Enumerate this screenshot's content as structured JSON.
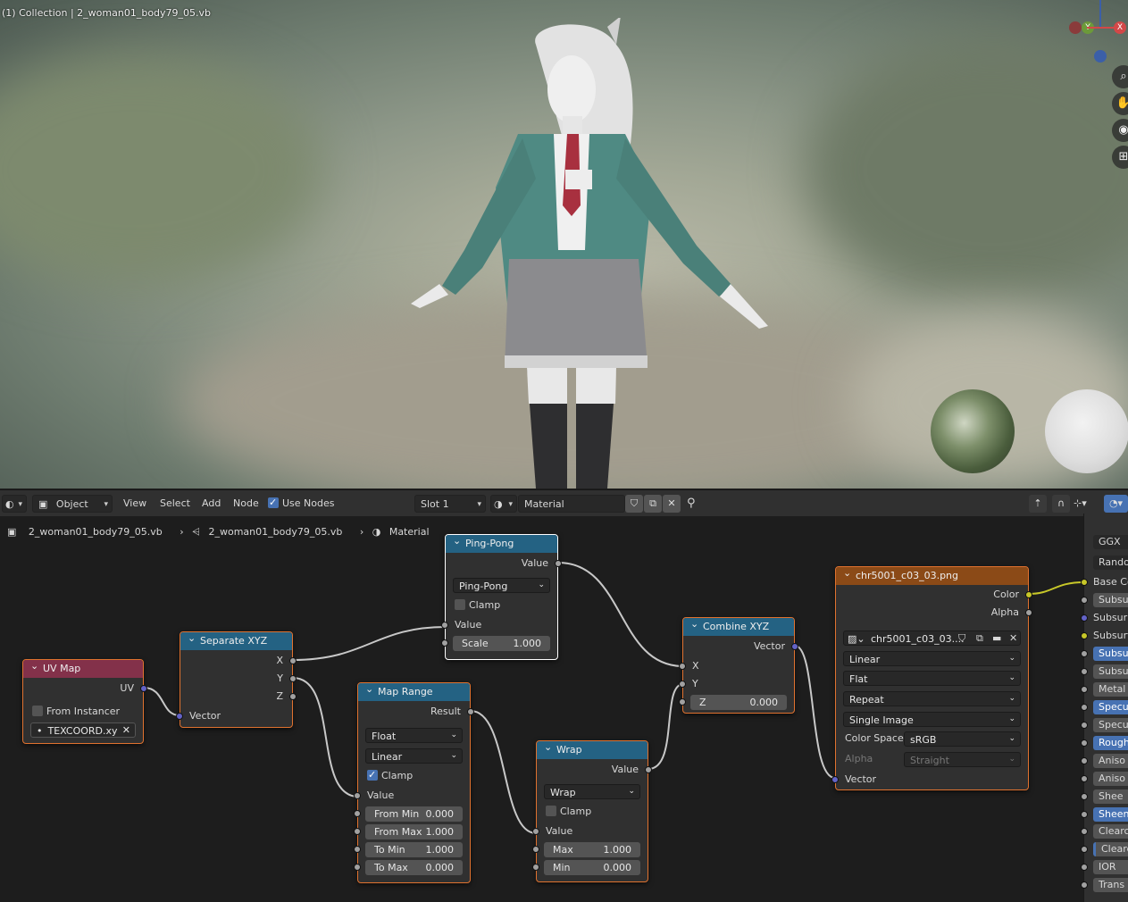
{
  "viewport": {
    "title": "(1) Collection | 2_woman01_body79_05.vb",
    "gizmo": {
      "x_label": "X",
      "y_label": "Y"
    },
    "nav_icons": [
      "zoom-icon",
      "pan-hand-icon",
      "camera-icon",
      "grid-icon"
    ]
  },
  "header": {
    "editor_type_icon": "node-editor-icon",
    "mode": "Object",
    "menus": [
      "View",
      "Select",
      "Add",
      "Node"
    ],
    "use_nodes_label": "Use Nodes",
    "use_nodes_checked": true,
    "slot": "Slot 1",
    "material_name": "Material"
  },
  "breadcrumb": {
    "object": "2_woman01_body79_05.vb",
    "mesh": "2_woman01_body79_05.vb",
    "material": "Material"
  },
  "nodes": {
    "uv_map": {
      "title": "UV Map",
      "out_uv": "UV",
      "from_instancer": "From Instancer",
      "uv_name": "TEXCOORD.xy"
    },
    "separate_xyz": {
      "title": "Separate XYZ",
      "x": "X",
      "y": "Y",
      "z": "Z",
      "vector": "Vector"
    },
    "ping_pong": {
      "title": "Ping-Pong",
      "out": "Value",
      "op": "Ping-Pong",
      "clamp": "Clamp",
      "value": "Value",
      "scale_label": "Scale",
      "scale_value": "1.000"
    },
    "map_range": {
      "title": "Map Range",
      "out": "Result",
      "type": "Float",
      "interp": "Linear",
      "clamp": "Clamp",
      "value": "Value",
      "from_min_label": "From Min",
      "from_min": "0.000",
      "from_max_label": "From Max",
      "from_max": "1.000",
      "to_min_label": "To Min",
      "to_min": "1.000",
      "to_max_label": "To Max",
      "to_max": "0.000"
    },
    "wrap": {
      "title": "Wrap",
      "out": "Value",
      "op": "Wrap",
      "clamp": "Clamp",
      "value": "Value",
      "max_label": "Max",
      "max": "1.000",
      "min_label": "Min",
      "min": "0.000"
    },
    "combine_xyz": {
      "title": "Combine XYZ",
      "out": "Vector",
      "x": "X",
      "y": "Y",
      "z_label": "Z",
      "z": "0.000"
    },
    "image_tex": {
      "title": "chr5001_c03_03.png",
      "color": "Color",
      "alpha": "Alpha",
      "image_name": "chr5001_c03_03....",
      "interp": "Linear",
      "proj": "Flat",
      "ext": "Repeat",
      "source": "Single Image",
      "color_space_label": "Color Space",
      "color_space": "sRGB",
      "alpha_label": "Alpha",
      "alpha_mode": "Straight",
      "vector": "Vector"
    }
  },
  "sidebar": {
    "rows": [
      "GGX",
      "Randor",
      "Base Co",
      "Subsu",
      "Subsur",
      "Subsurfa",
      "Subsu",
      "Subsu",
      "Metal",
      "Specu",
      "Specu",
      "Rough",
      "Aniso",
      "Aniso",
      "Shee",
      "Sheen",
      "Clearc",
      "Clearc",
      "IOR",
      "Trans"
    ]
  },
  "colors": {
    "converter_header": "#246283",
    "input_header": "#83314a",
    "texture_header": "#8b4a17",
    "selected_outline": "#e0722f",
    "link": "#c8c8c8"
  }
}
